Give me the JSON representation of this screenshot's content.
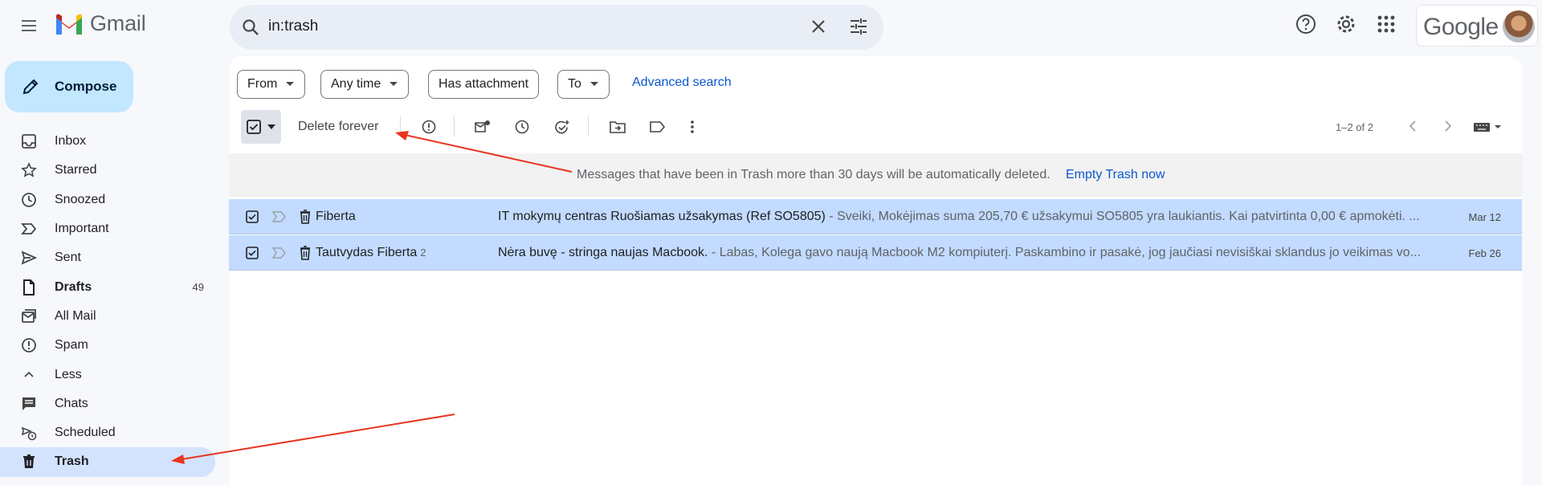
{
  "header": {
    "app_name": "Gmail",
    "search_value": "in:trash",
    "brand_text": "Google"
  },
  "sidebar": {
    "compose_label": "Compose",
    "items": [
      {
        "label": "Inbox",
        "icon": "inbox-icon",
        "count": ""
      },
      {
        "label": "Starred",
        "icon": "star-icon",
        "count": ""
      },
      {
        "label": "Snoozed",
        "icon": "clock-icon",
        "count": ""
      },
      {
        "label": "Important",
        "icon": "important-icon",
        "count": ""
      },
      {
        "label": "Sent",
        "icon": "send-icon",
        "count": ""
      },
      {
        "label": "Drafts",
        "icon": "draft-icon",
        "count": "49"
      },
      {
        "label": "All Mail",
        "icon": "all-mail-icon",
        "count": ""
      },
      {
        "label": "Spam",
        "icon": "spam-icon",
        "count": ""
      },
      {
        "label": "Less",
        "icon": "chevron-up-icon",
        "count": ""
      },
      {
        "label": "Chats",
        "icon": "chat-icon",
        "count": ""
      },
      {
        "label": "Scheduled",
        "icon": "scheduled-icon",
        "count": ""
      },
      {
        "label": "Trash",
        "icon": "trash-icon",
        "count": ""
      }
    ]
  },
  "filters": {
    "from": "From",
    "any_time": "Any time",
    "has_attachment": "Has attachment",
    "to": "To",
    "advanced_search": "Advanced search"
  },
  "toolbar": {
    "delete_forever": "Delete forever",
    "pagination": "1–2 of 2"
  },
  "banner": {
    "message": "Messages that have been in Trash more than 30 days will be automatically deleted.",
    "action": "Empty Trash now"
  },
  "emails": [
    {
      "sender": "Fiberta",
      "thread_count": "",
      "subject": "IT mokymų centras Ruošiamas užsakymas (Ref SO5805)",
      "snippet": " - Sveiki, Mokėjimas suma 205,70 € užsakymui SO5805 yra laukiantis. Kai patvirtinta 0,00 € apmokėti. ...",
      "date": "Mar 12"
    },
    {
      "sender": "Tautvydas Fiberta",
      "thread_count": "2",
      "subject": "Nėra buvę - stringa naujas Macbook.",
      "snippet": " - Labas, Kolega gavo naują Macbook M2 kompiuterį. Paskambino ir pasakė, jog jaučiasi nevisiškai sklandus jo veikimas vo...",
      "date": "Feb 26"
    }
  ],
  "colors": {
    "accent": "#0b57d0",
    "selected_row": "#c2dbff",
    "compose_bg": "#c2e7ff",
    "active_nav": "#d3e3fd",
    "annotation_arrow": "#e8351f"
  }
}
